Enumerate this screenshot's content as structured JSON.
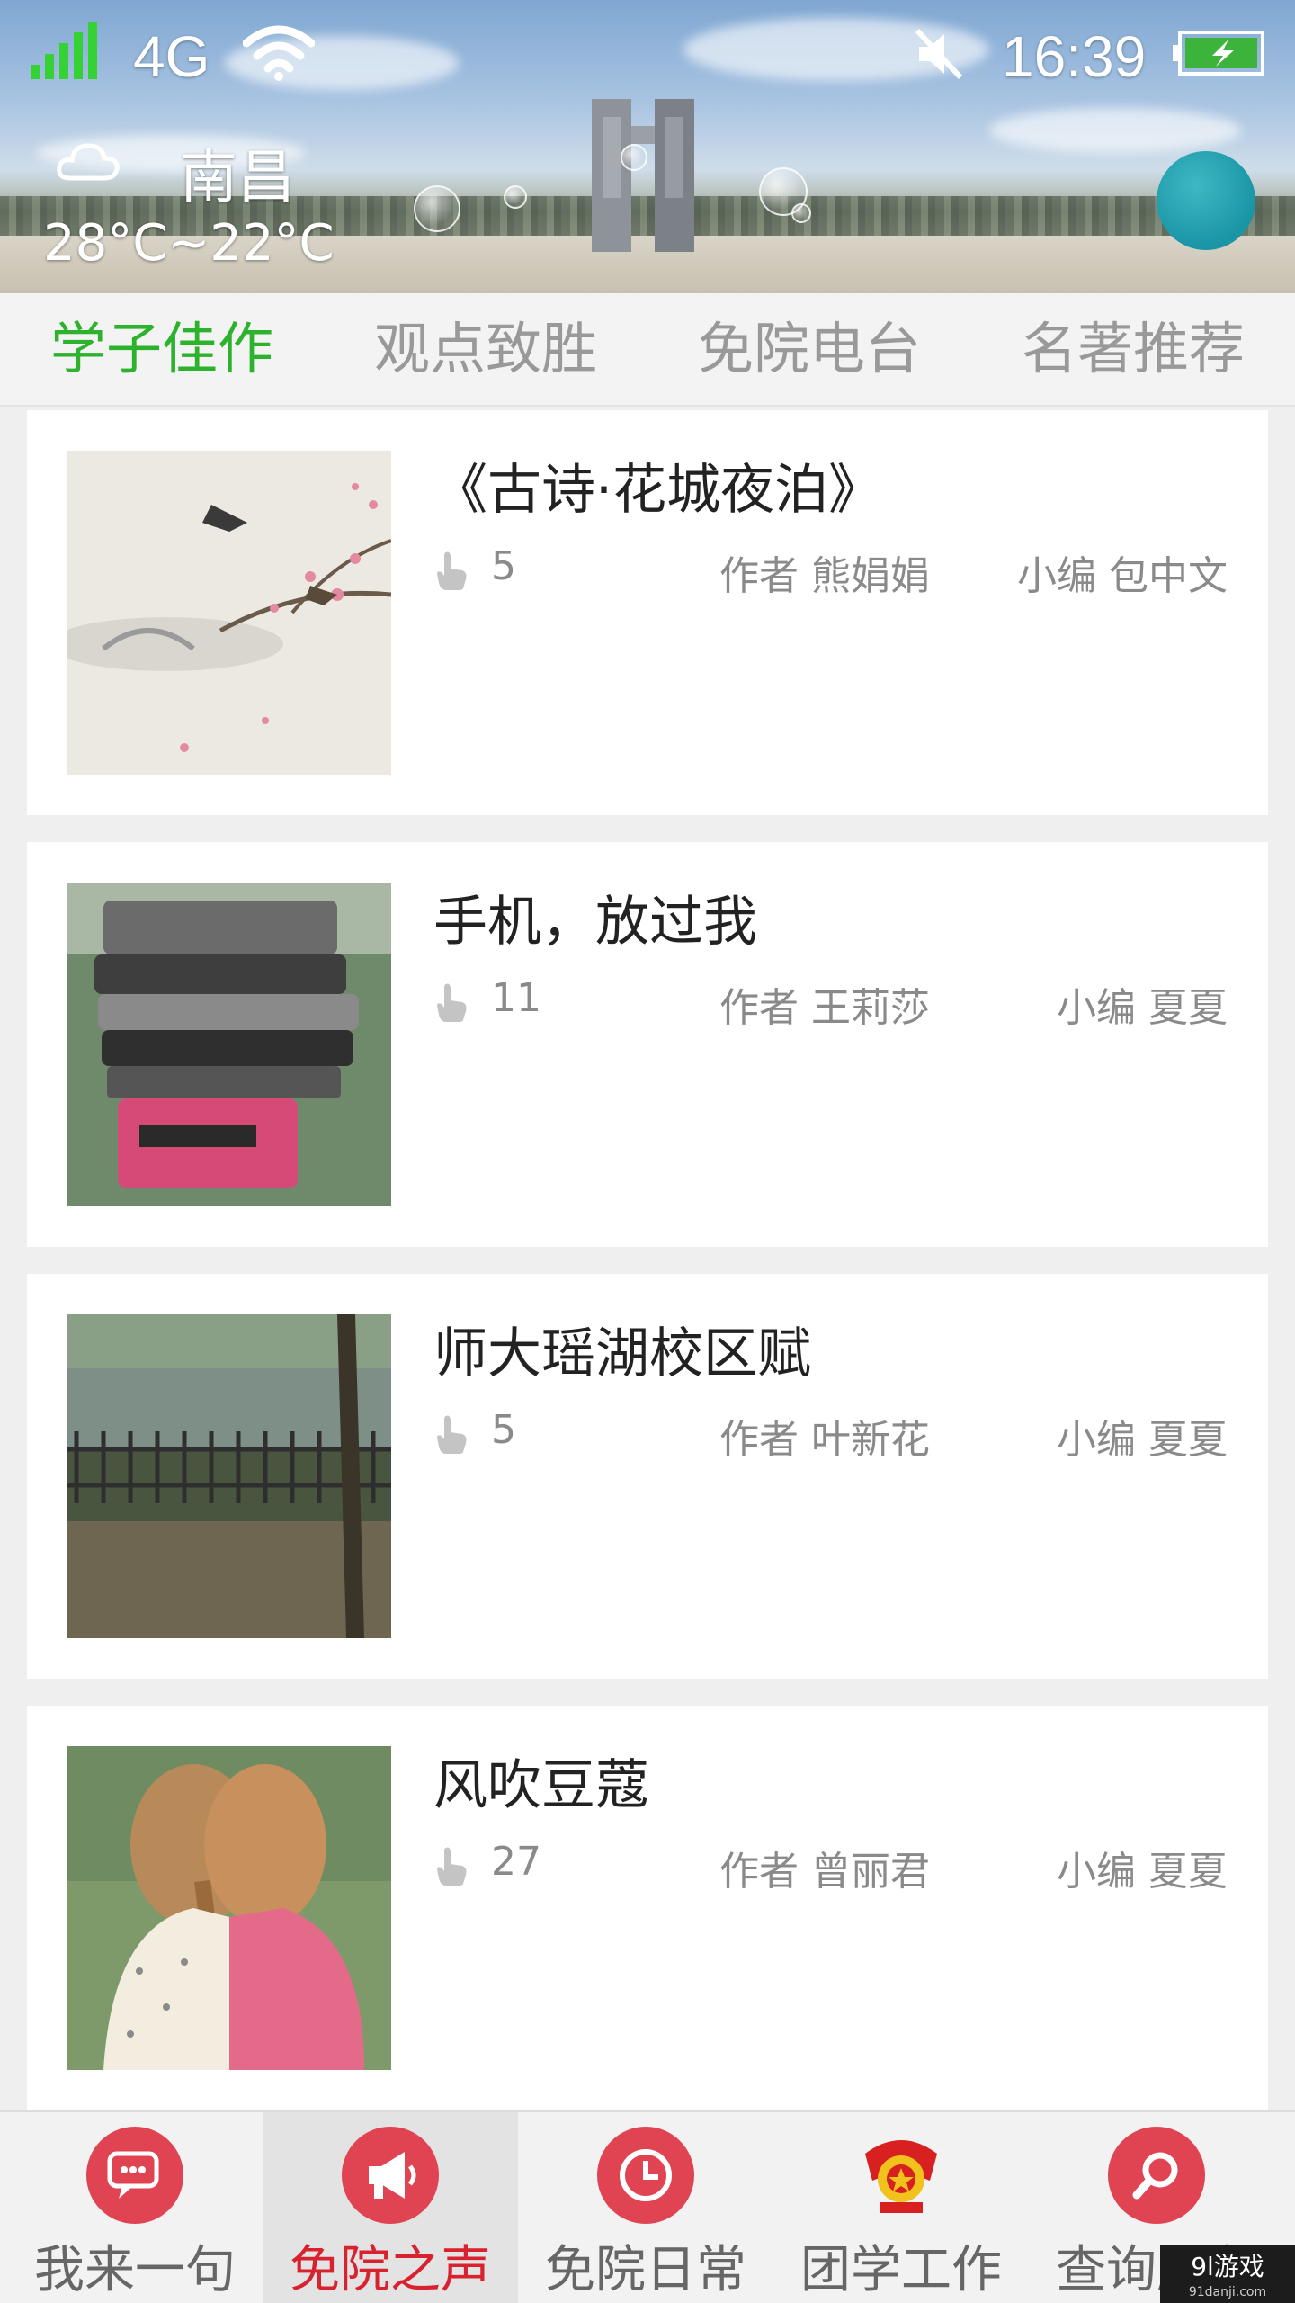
{
  "status_bar": {
    "network": "4G",
    "time": "16:39"
  },
  "weather": {
    "city": "南昌",
    "temperature": "28°C~22°C"
  },
  "tabs": [
    {
      "label": "学子佳作",
      "active": true
    },
    {
      "label": "观点致胜",
      "active": false
    },
    {
      "label": "免院电台",
      "active": false
    },
    {
      "label": "名著推荐",
      "active": false
    }
  ],
  "articles": [
    {
      "title": "《古诗·花城夜泊》",
      "likes": "5",
      "author": "作者 熊娟娟",
      "editor": "小编 包中文"
    },
    {
      "title": "手机，放过我",
      "likes": "11",
      "author": "作者 王莉莎",
      "editor": "小编 夏夏"
    },
    {
      "title": "师大瑶湖校区赋",
      "likes": "5",
      "author": "作者 叶新花",
      "editor": "小编 夏夏"
    },
    {
      "title": "风吹豆蔻",
      "likes": "27",
      "author": "作者 曾丽君",
      "editor": "小编 夏夏"
    }
  ],
  "bottom_nav": [
    {
      "label": "我来一句",
      "icon": "chat-icon",
      "active": false
    },
    {
      "label": "免院之声",
      "icon": "megaphone-icon",
      "active": true
    },
    {
      "label": "免院日常",
      "icon": "clock-icon",
      "active": false
    },
    {
      "label": "团学工作",
      "icon": "youth-league-emblem-icon",
      "active": false
    },
    {
      "label": "查询服务",
      "icon": "search-icon",
      "active": false
    }
  ],
  "watermark": {
    "brand": "9l游戏",
    "site": "91danji.com"
  },
  "colors": {
    "active_tab": "#2db22d",
    "active_nav": "#d8222f",
    "nav_icon_bg": "#e04452"
  }
}
